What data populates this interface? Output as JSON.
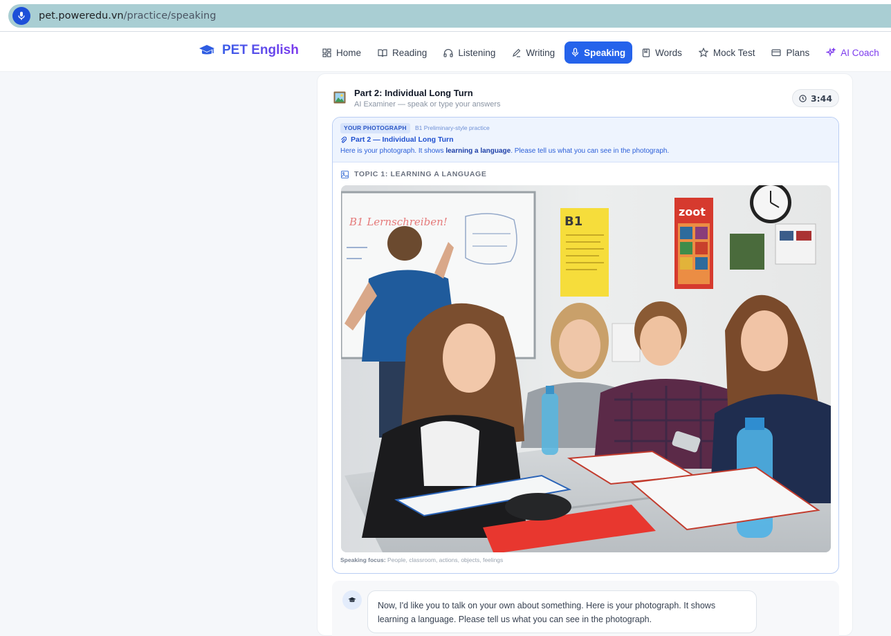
{
  "browser": {
    "url_host": "pet.poweredu.vn",
    "url_path": "/practice/speaking"
  },
  "brand": {
    "name": "PET English"
  },
  "nav": {
    "items": [
      {
        "label": "Home",
        "icon": "grid-icon"
      },
      {
        "label": "Reading",
        "icon": "book-open-icon"
      },
      {
        "label": "Listening",
        "icon": "headphones-icon"
      },
      {
        "label": "Writing",
        "icon": "pen-icon"
      },
      {
        "label": "Speaking",
        "icon": "mic-icon",
        "active": true
      },
      {
        "label": "Words",
        "icon": "bookmark-book-icon"
      },
      {
        "label": "Mock Test",
        "icon": "star-icon"
      },
      {
        "label": "Plans",
        "icon": "card-icon"
      },
      {
        "label": "AI Coach",
        "icon": "sparkles-icon"
      }
    ],
    "accent_color": "#2563eb",
    "coach_color": "#7c3aed"
  },
  "session": {
    "title": "Part 2: Individual Long Turn",
    "subtitle": "AI Examiner — speak or type your answers",
    "timer": "3:44"
  },
  "photo_card": {
    "tag": "YOUR PHOTOGRAPH",
    "tag_sub": "B1 Preliminary-style practice",
    "part_label": "Part 2 — Individual Long Turn",
    "desc_before": "Here is your photograph. It shows ",
    "desc_bold": "learning a language",
    "desc_after": ". Please tell us what you can see in the photograph.",
    "topic": "TOPIC 1: LEARNING A LANGUAGE",
    "focus_label": "Speaking focus:",
    "focus_text": " People, classroom, actions, objects, feelings",
    "photo_text": {
      "whiteboard_left": "B1 Lernschreiben!",
      "poster_b1": "B1",
      "poster_zoot": "zoot"
    }
  },
  "chat": {
    "examiner_message": "Now, I'd like you to talk on your own about something. Here is your photograph. It shows learning a language. Please tell us what you can see in the photograph."
  }
}
